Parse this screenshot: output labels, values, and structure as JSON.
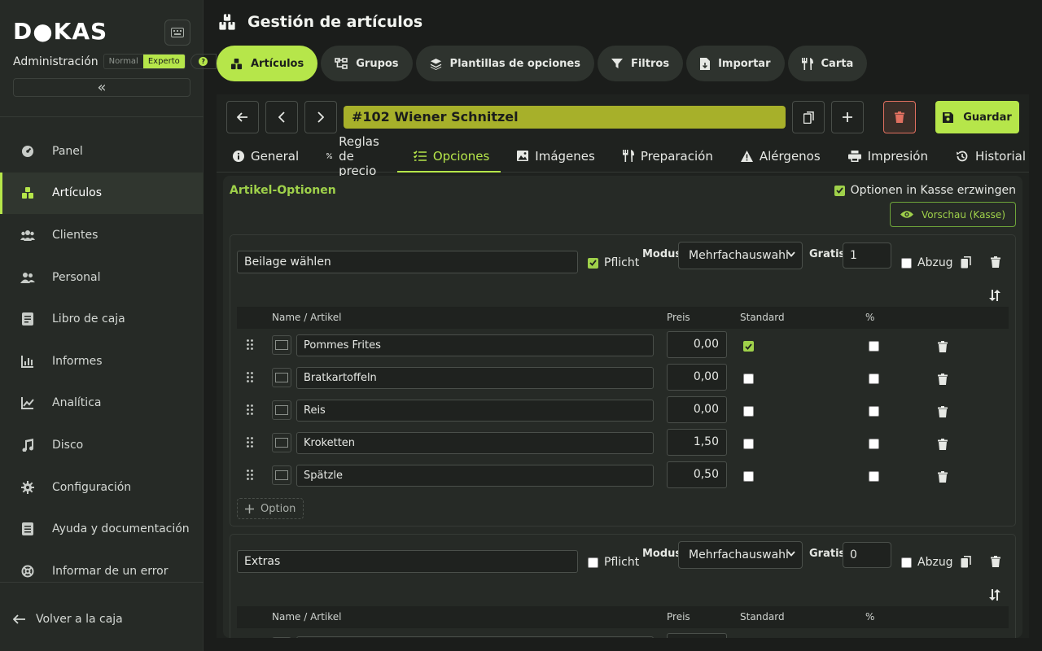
{
  "sidebar": {
    "logo": "D●KAS",
    "admin_label": "Administración",
    "mode_normal": "Normal",
    "mode_expert": "Experto",
    "help_symbol": "?",
    "collapse_symbol": "«",
    "items": [
      {
        "label": "Panel",
        "icon": "dashboard-icon"
      },
      {
        "label": "Artículos",
        "icon": "articles-icon"
      },
      {
        "label": "Clientes",
        "icon": "clients-icon"
      },
      {
        "label": "Personal",
        "icon": "staff-icon"
      },
      {
        "label": "Libro de caja",
        "icon": "cashbook-icon"
      },
      {
        "label": "Informes",
        "icon": "reports-icon"
      },
      {
        "label": "Analítica",
        "icon": "analytics-icon"
      },
      {
        "label": "Disco",
        "icon": "music-icon"
      },
      {
        "label": "Configuración",
        "icon": "gear-icon"
      },
      {
        "label": "Ayuda y documentación",
        "icon": "docs-icon"
      },
      {
        "label": "Informar de un error",
        "icon": "bug-icon"
      }
    ],
    "back_label": "Volver a la caja"
  },
  "header": {
    "title": "Gestión de artículos"
  },
  "top_tabs": [
    {
      "label": "Artículos",
      "icon": "articles-icon"
    },
    {
      "label": "Grupos",
      "icon": "groups-icon"
    },
    {
      "label": "Plantillas de opciones",
      "icon": "layers-icon"
    },
    {
      "label": "Filtros",
      "icon": "filter-icon"
    },
    {
      "label": "Importar",
      "icon": "import-icon"
    },
    {
      "label": "Carta",
      "icon": "cutlery-icon"
    }
  ],
  "editor": {
    "article_title": "#102 Wiener Schnitzel",
    "save_label": "Guardar",
    "sub_tabs": [
      {
        "label": "General",
        "icon": "info-icon"
      },
      {
        "label": "Reglas de precio",
        "icon": "percent-icon"
      },
      {
        "label": "Opciones",
        "icon": "checklist-icon"
      },
      {
        "label": "Imágenes",
        "icon": "image-icon"
      },
      {
        "label": "Preparación",
        "icon": "cutlery-icon"
      },
      {
        "label": "Alérgenos",
        "icon": "warning-icon"
      },
      {
        "label": "Impresión",
        "icon": "printer-icon"
      },
      {
        "label": "Historial",
        "icon": "history-icon"
      }
    ]
  },
  "options_panel": {
    "title": "Artikel-Optionen",
    "force_label": "Optionen in Kasse erzwingen",
    "force_checked": true,
    "preview_label": "Vorschau (Kasse)",
    "groups": [
      {
        "name": "Beilage wählen",
        "required_label": "Pflicht",
        "required": true,
        "mode_label": "Modus",
        "mode_value": "Mehrfachauswahl",
        "free_label": "Gratis",
        "free_value": "1",
        "deduct_label": "Abzug",
        "deduct": false,
        "columns": [
          "Name / Artikel",
          "Preis",
          "Standard",
          "%"
        ],
        "rows": [
          {
            "name": "Pommes Frites",
            "price": "0,00",
            "standard": true,
            "percent": false
          },
          {
            "name": "Bratkartoffeln",
            "price": "0,00",
            "standard": false,
            "percent": false
          },
          {
            "name": "Reis",
            "price": "0,00",
            "standard": false,
            "percent": false
          },
          {
            "name": "Kroketten",
            "price": "1,50",
            "standard": false,
            "percent": false
          },
          {
            "name": "Spätzle",
            "price": "0,50",
            "standard": false,
            "percent": false
          }
        ],
        "add_label": "Option"
      },
      {
        "name": "Extras",
        "required_label": "Pflicht",
        "required": false,
        "mode_label": "Modus",
        "mode_value": "Mehrfachauswahl",
        "free_label": "Gratis",
        "free_value": "0",
        "deduct_label": "Abzug",
        "deduct": false,
        "columns": [
          "Name / Artikel",
          "Preis",
          "Standard",
          "%"
        ]
      }
    ]
  },
  "colors": {
    "accent": "#b6e64a",
    "title_bar": "#a7b02a",
    "danger": "#e07060"
  }
}
